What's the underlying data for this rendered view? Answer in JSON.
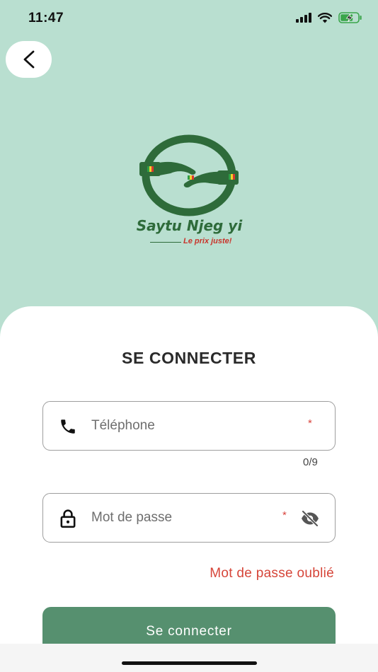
{
  "status_bar": {
    "time": "11:47"
  },
  "logo": {
    "name": "Saytu Njeg yi",
    "tagline": "Le prix juste!"
  },
  "form": {
    "title": "SE CONNECTER",
    "phone": {
      "placeholder": "Téléphone",
      "required_mark": "*",
      "counter": "0/9"
    },
    "password": {
      "placeholder": "Mot de passe",
      "required_mark": "*"
    },
    "forgot_password_label": "Mot de passe oublié",
    "submit_label": "Se connecter"
  },
  "colors": {
    "background": "#b9dfd0",
    "brand_green": "#2e6b3a",
    "button_green": "#56906f",
    "link_red": "#d64539"
  },
  "icons": [
    "back-arrow-icon",
    "phone-icon",
    "lock-icon",
    "eye-off-icon",
    "signal-icon",
    "wifi-icon",
    "battery-charging-icon"
  ]
}
